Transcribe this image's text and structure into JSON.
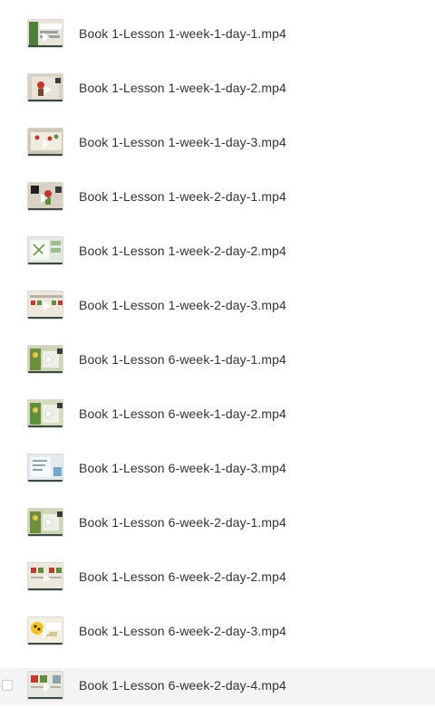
{
  "files": [
    {
      "name": "Book 1-Lesson 1-week-1-day-1.mp4",
      "icon": "video-thumbnail-icon"
    },
    {
      "name": "Book 1-Lesson 1-week-1-day-2.mp4",
      "icon": "video-thumbnail-icon"
    },
    {
      "name": "Book 1-Lesson 1-week-1-day-3.mp4",
      "icon": "video-thumbnail-icon"
    },
    {
      "name": "Book 1-Lesson 1-week-2-day-1.mp4",
      "icon": "video-thumbnail-icon"
    },
    {
      "name": "Book 1-Lesson 1-week-2-day-2.mp4",
      "icon": "video-thumbnail-icon"
    },
    {
      "name": "Book 1-Lesson 1-week-2-day-3.mp4",
      "icon": "video-thumbnail-icon"
    },
    {
      "name": "Book 1-Lesson 6-week-1-day-1.mp4",
      "icon": "video-thumbnail-icon"
    },
    {
      "name": "Book 1-Lesson 6-week-1-day-2.mp4",
      "icon": "video-thumbnail-icon"
    },
    {
      "name": "Book 1-Lesson 6-week-1-day-3.mp4",
      "icon": "video-thumbnail-icon"
    },
    {
      "name": "Book 1-Lesson 6-week-2-day-1.mp4",
      "icon": "video-thumbnail-icon"
    },
    {
      "name": "Book 1-Lesson 6-week-2-day-2.mp4",
      "icon": "video-thumbnail-icon"
    },
    {
      "name": "Book 1-Lesson 6-week-2-day-3.mp4",
      "icon": "video-thumbnail-icon"
    },
    {
      "name": "Book 1-Lesson 6-week-2-day-4.mp4",
      "icon": "video-thumbnail-icon"
    }
  ],
  "colors": {
    "text": "#333333",
    "hover_row": "#f4f4f5",
    "thumb_bg": "#d8d2c4",
    "thumb_green": "#5f8f3a",
    "thumb_red": "#c0392b"
  }
}
